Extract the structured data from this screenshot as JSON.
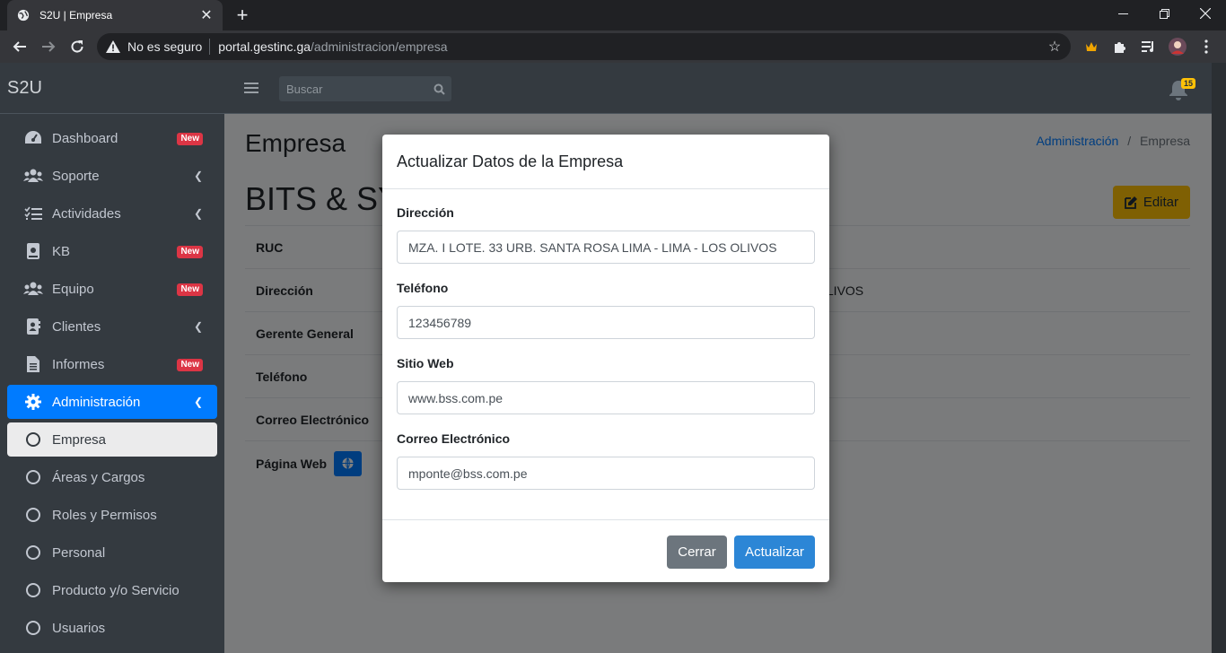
{
  "browser": {
    "tab_title": "S2U | Empresa",
    "security_label": "No es seguro",
    "url_host": "portal.gestinc.ga",
    "url_path": "/administracion/empresa"
  },
  "app": {
    "brand": "S2U",
    "search_placeholder": "Buscar",
    "notification_count": "15"
  },
  "sidebar": {
    "items": [
      {
        "label": "Dashboard",
        "icon": "dashboard-icon",
        "badge": "New"
      },
      {
        "label": "Soporte",
        "icon": "users-icon"
      },
      {
        "label": "Actividades",
        "icon": "tasks-icon"
      },
      {
        "label": "KB",
        "icon": "book-icon",
        "badge": "New"
      },
      {
        "label": "Equipo",
        "icon": "users-icon",
        "badge": "New"
      },
      {
        "label": "Clientes",
        "icon": "address-book-icon"
      },
      {
        "label": "Informes",
        "icon": "file-icon",
        "badge": "New"
      },
      {
        "label": "Administración",
        "icon": "gear-icon"
      },
      {
        "label": "Empresa"
      },
      {
        "label": "Áreas y Cargos"
      },
      {
        "label": "Roles y Permisos"
      },
      {
        "label": "Personal"
      },
      {
        "label": "Producto y/o Servicio"
      },
      {
        "label": "Usuarios"
      }
    ]
  },
  "page": {
    "title": "Empresa",
    "breadcrumb_parent": "Administración",
    "breadcrumb_sep": "/",
    "breadcrumb_current": "Empresa",
    "company_name": "BITS & SY",
    "edit_label": "Editar",
    "rows": [
      {
        "label": "RUC",
        "value": ""
      },
      {
        "label": "Dirección",
        "value": "OLIVOS"
      },
      {
        "label": "Gerente General",
        "value": ""
      },
      {
        "label": "Teléfono",
        "value": ""
      },
      {
        "label": "Correo Electrónico",
        "value": ""
      },
      {
        "label": "Página Web",
        "value": ""
      }
    ]
  },
  "modal": {
    "title": "Actualizar Datos de la Empresa",
    "fields": [
      {
        "label": "Dirección",
        "value": "MZA. I LOTE. 33 URB. SANTA ROSA LIMA - LIMA - LOS OLIVOS"
      },
      {
        "label": "Teléfono",
        "value": "123456789"
      },
      {
        "label": "Sitio Web",
        "value": "www.bss.com.pe"
      },
      {
        "label": "Correo Electrónico",
        "value": "mponte@bss.com.pe"
      }
    ],
    "close_label": "Cerrar",
    "update_label": "Actualizar"
  }
}
